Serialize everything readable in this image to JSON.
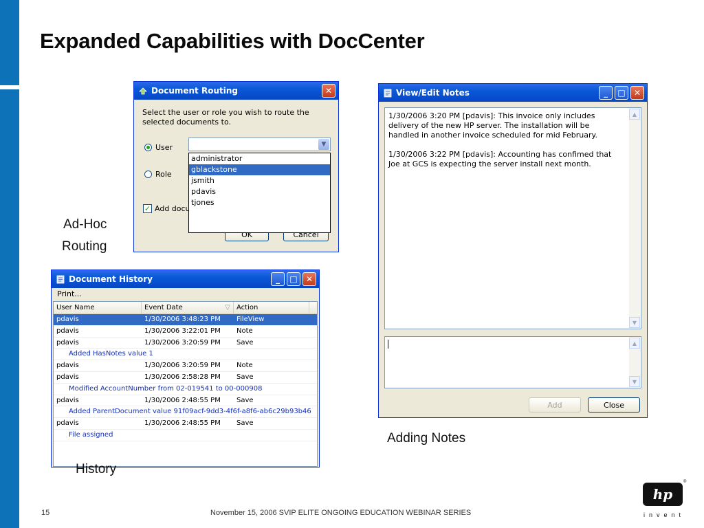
{
  "slide": {
    "title": "Expanded Capabilities with DocCenter",
    "page_number": "15",
    "footer": "November 15, 2006 SVIP ELITE ONGOING EDUCATION WEBINAR SERIES",
    "logo_text": "hp",
    "logo_tagline": "invent",
    "registered_mark": "®",
    "accent_color": "#0e72b8"
  },
  "captions": {
    "adhoc_line1": "Ad-Hoc",
    "adhoc_line2": "Routing",
    "adding_notes": "Adding Notes",
    "history": "History"
  },
  "routing_dialog": {
    "title": "Document Routing",
    "instruction": "Select the user or role you wish to route the selected documents to.",
    "option_user": "User",
    "option_role": "Role",
    "selected_option": "User",
    "combo_value": "",
    "dropdown_items": [
      "administrator",
      "gblackstone",
      "jsmith",
      "pdavis",
      "tjones"
    ],
    "highlighted_item": "gblackstone",
    "checkbox_label": "Add docu",
    "checkbox_checked": true,
    "ok_label": "OK",
    "cancel_label": "Cancel",
    "close_glyph": "✕",
    "arrow_glyph": "▼"
  },
  "notes_dialog": {
    "title": "View/Edit Notes",
    "notes": [
      "1/30/2006 3:20 PM [pdavis]: This invoice only includes delivery of the new HP server. The installation will be handled in another invoice scheduled for mid February.",
      "1/30/2006 3:22 PM [pdavis]: Accounting has confimed that Joe at GCS is expecting the server install next month."
    ],
    "new_note_value": "",
    "add_label": "Add",
    "close_label": "Close",
    "min_glyph": "_",
    "max_glyph": "□",
    "close_glyph": "✕",
    "up_glyph": "▲",
    "down_glyph": "▼"
  },
  "history_dialog": {
    "title": "Document History",
    "toolbar_print": "Print...",
    "columns": [
      "User Name",
      "Event Date",
      "Action"
    ],
    "sort_glyph": "▽",
    "rows": [
      {
        "user": "pdavis",
        "date": "1/30/2006 3:48:23 PM",
        "action": "FileView",
        "detail": ""
      },
      {
        "user": "pdavis",
        "date": "1/30/2006 3:22:01 PM",
        "action": "Note",
        "detail": ""
      },
      {
        "user": "pdavis",
        "date": "1/30/2006 3:20:59 PM",
        "action": "Save",
        "detail": "Added HasNotes value 1"
      },
      {
        "user": "pdavis",
        "date": "1/30/2006 3:20:59 PM",
        "action": "Note",
        "detail": ""
      },
      {
        "user": "pdavis",
        "date": "1/30/2006 2:58:28 PM",
        "action": "Save",
        "detail": "Modified AccountNumber from 02-019541 to 00-000908"
      },
      {
        "user": "pdavis",
        "date": "1/30/2006 2:48:55 PM",
        "action": "Save",
        "detail": "Added ParentDocument value 91f09acf-9dd3-4f6f-a8f6-ab6c29b93b46"
      },
      {
        "user": "pdavis",
        "date": "1/30/2006 2:48:55 PM",
        "action": "Save",
        "detail": "File assigned"
      }
    ],
    "min_glyph": "_",
    "max_glyph": "□",
    "close_glyph": "✕"
  }
}
